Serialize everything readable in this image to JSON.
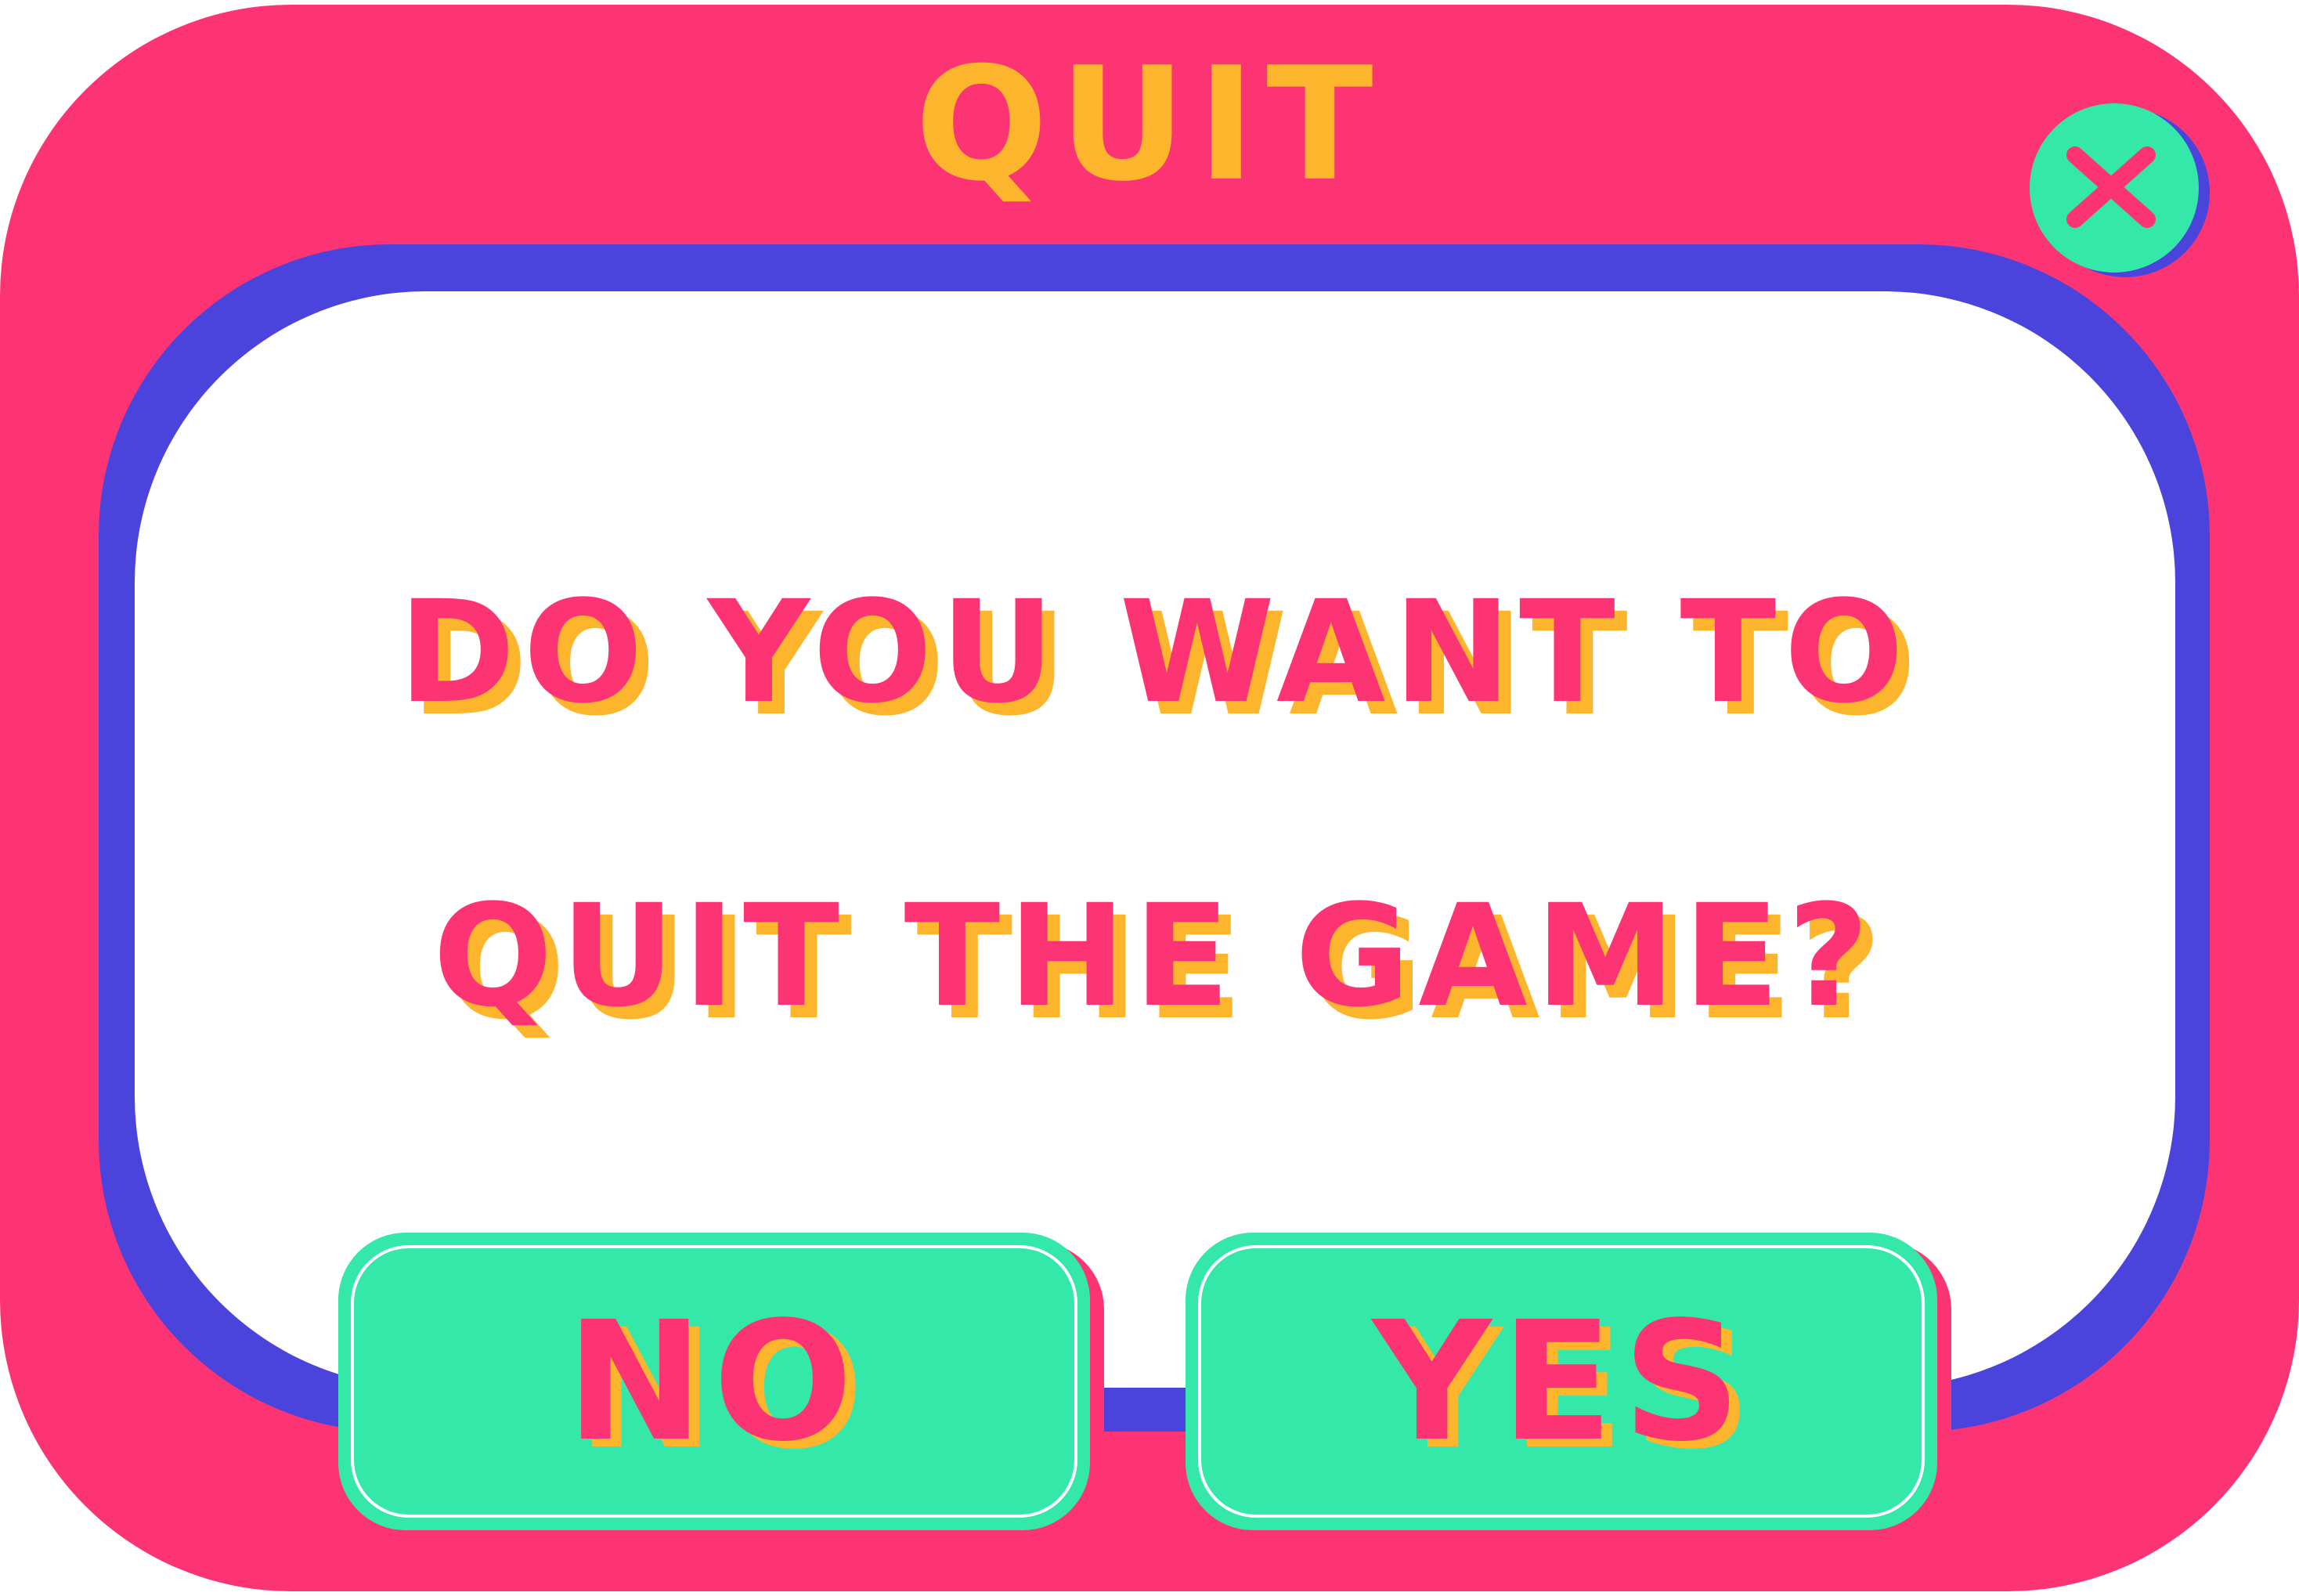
{
  "dialog": {
    "title": "QUIT",
    "message_line1": "DO YOU WANT TO",
    "message_line2": "QUIT THE GAME?",
    "close_icon": "close-x-icon"
  },
  "buttons": {
    "no_label": "NO",
    "yes_label": "YES"
  },
  "colors": {
    "frame": "#fd3474",
    "panel_border": "#4a43dc",
    "panel": "#ffffff",
    "button": "#34e8aa",
    "text_primary": "#fd3474",
    "text_shadow": "#fdb52e"
  }
}
